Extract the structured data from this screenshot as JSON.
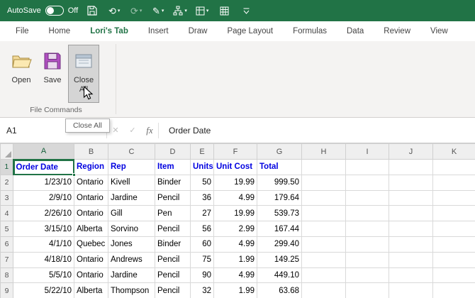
{
  "colors": {
    "excel_green": "#217346",
    "header_text_blue": "#0000E0",
    "selection_green": "#217346"
  },
  "titlebar": {
    "autosave_label": "AutoSave",
    "autosave_state": "Off",
    "icons": {
      "undo_glyph": "⟲",
      "redo_glyph": "⟳",
      "pen_glyph": "✎",
      "caret_glyph": "▾"
    }
  },
  "ribbon": {
    "tabs": [
      "File",
      "Home",
      "Lori's Tab",
      "Insert",
      "Draw",
      "Page Layout",
      "Formulas",
      "Data",
      "Review",
      "View"
    ],
    "active_tab": "Lori's Tab",
    "buttons": {
      "open": "Open",
      "save": "Save",
      "close_all_line1": "Close",
      "close_all_line2": "All"
    },
    "group_label": "File Commands",
    "tooltip": "Close All"
  },
  "formula_bar": {
    "name_box": "A1",
    "cancel_glyph": "✕",
    "enter_glyph": "✓",
    "fx_label": "fx",
    "value": "Order Date"
  },
  "grid": {
    "active_cell": "A1",
    "columns": [
      "A",
      "B",
      "C",
      "D",
      "E",
      "F",
      "G",
      "H",
      "I",
      "J",
      "K"
    ],
    "row_numbers": [
      "1",
      "2",
      "3",
      "4",
      "5",
      "6",
      "7",
      "8",
      "9"
    ],
    "header_row": [
      "Order Date",
      "Region",
      "Rep",
      "Item",
      "Units",
      "Unit Cost",
      "Total"
    ],
    "rows": [
      [
        "1/23/10",
        "Ontario",
        "Kivell",
        "Binder",
        "50",
        "19.99",
        "999.50"
      ],
      [
        "2/9/10",
        "Ontario",
        "Jardine",
        "Pencil",
        "36",
        "4.99",
        "179.64"
      ],
      [
        "2/26/10",
        "Ontario",
        "Gill",
        "Pen",
        "27",
        "19.99",
        "539.73"
      ],
      [
        "3/15/10",
        "Alberta",
        "Sorvino",
        "Pencil",
        "56",
        "2.99",
        "167.44"
      ],
      [
        "4/1/10",
        "Quebec",
        "Jones",
        "Binder",
        "60",
        "4.99",
        "299.40"
      ],
      [
        "4/18/10",
        "Ontario",
        "Andrews",
        "Pencil",
        "75",
        "1.99",
        "149.25"
      ],
      [
        "5/5/10",
        "Ontario",
        "Jardine",
        "Pencil",
        "90",
        "4.99",
        "449.10"
      ],
      [
        "5/22/10",
        "Alberta",
        "Thompson",
        "Pencil",
        "32",
        "1.99",
        "63.68"
      ]
    ]
  }
}
